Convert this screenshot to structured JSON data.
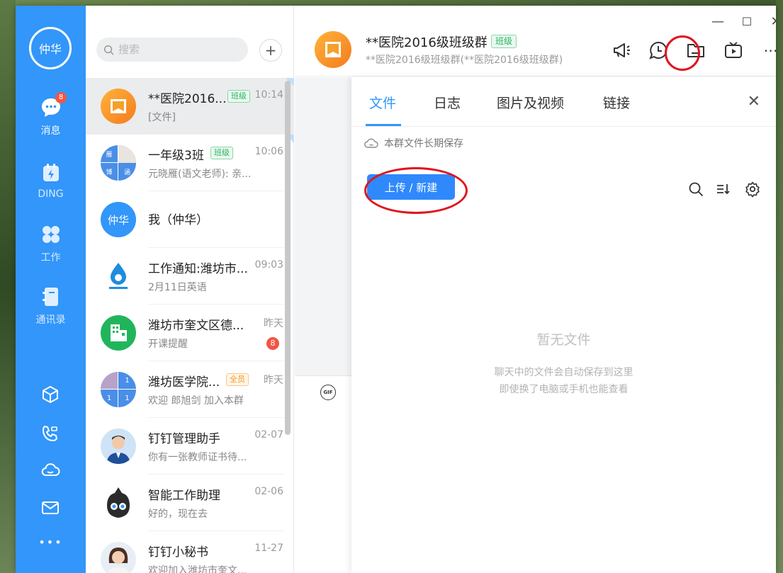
{
  "nav": {
    "me_label": "仲华",
    "items": [
      {
        "label": "消息",
        "badge": "8"
      },
      {
        "label": "DING"
      },
      {
        "label": "工作"
      },
      {
        "label": "通讯录"
      }
    ],
    "more": "•••"
  },
  "search": {
    "placeholder": "搜索"
  },
  "add_button": "+",
  "conversations": [
    {
      "name": "**医院2016...",
      "tag": "班级",
      "time": "10:14",
      "snippet": "[文件]"
    },
    {
      "name": "一年级3班",
      "tag": "班级",
      "time": "10:06",
      "snippet": "元晓雁(语文老师): 亲..."
    },
    {
      "name": "我（仲华）",
      "avatar_text": "仲华"
    },
    {
      "name": "工作通知:潍坊市...",
      "time": "09:03",
      "snippet": "2月11日英语"
    },
    {
      "name": "潍坊市奎文区德...",
      "time": "昨天",
      "snippet": "开课提醒",
      "badge": "8"
    },
    {
      "name": "潍坊医学院...",
      "tag": "全员",
      "time": "昨天",
      "snippet": "欢迎 郎旭剑 加入本群"
    },
    {
      "name": "钉钉管理助手",
      "time": "02-07",
      "snippet": "你有一张教师证书待..."
    },
    {
      "name": "智能工作助理",
      "time": "02-06",
      "snippet": "好的，现在去"
    },
    {
      "name": "钉钉小秘书",
      "time": "11-27",
      "snippet": "欢迎加入潍坊市奎文..."
    }
  ],
  "avatar_chars": {
    "c2": [
      "雁",
      "博",
      "涵"
    ],
    "c6": [
      "1",
      "1",
      "1",
      "1"
    ]
  },
  "chat": {
    "title": "**医院2016级班级群",
    "tag": "班级",
    "subtitle": "**医院2016级班级群(**医院2016级班级群)"
  },
  "window_controls": {
    "minimize": "—",
    "maximize": "☐",
    "close": "✕"
  },
  "panel": {
    "tabs": [
      "文件",
      "日志",
      "图片及视频",
      "链接"
    ],
    "close": "✕",
    "notice": "本群文件长期保存",
    "upload_label": "上传 / 新建",
    "empty_title": "暂无文件",
    "empty_tip_1": "聊天中的文件会自动保存到这里",
    "empty_tip_2": "即使换了电脑或手机也能查看"
  },
  "chat_toolbar": {
    "gif": "GIF"
  },
  "colors": {
    "brand": "#3296fa",
    "badge": "#f25643",
    "annotation": "#e0141e"
  }
}
